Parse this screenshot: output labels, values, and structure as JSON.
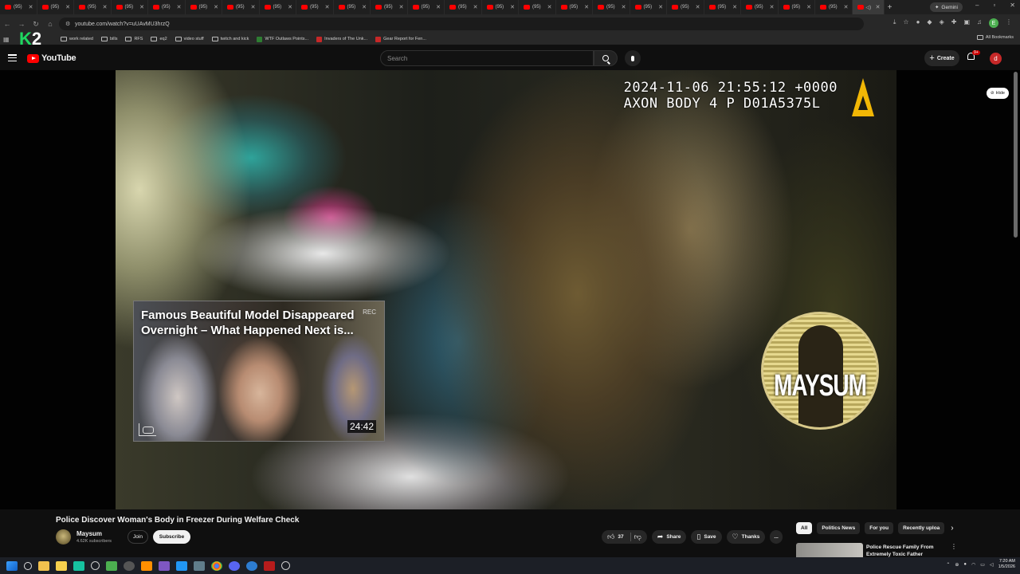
{
  "browser": {
    "tabs": [
      {
        "label": "(95)"
      },
      {
        "label": "(95)"
      },
      {
        "label": "(95)"
      },
      {
        "label": "(95)"
      },
      {
        "label": "(95)"
      },
      {
        "label": "(95)"
      },
      {
        "label": "(95)"
      },
      {
        "label": "(95)"
      },
      {
        "label": "(95)"
      },
      {
        "label": "(95)"
      },
      {
        "label": "(95)"
      },
      {
        "label": "(95)"
      },
      {
        "label": "(95)"
      },
      {
        "label": "(95)"
      },
      {
        "label": "(95)"
      },
      {
        "label": "(95)"
      },
      {
        "label": "(95)"
      },
      {
        "label": "(95)"
      },
      {
        "label": "(95)"
      },
      {
        "label": "(95)"
      },
      {
        "label": "(95)"
      },
      {
        "label": "(95)"
      },
      {
        "label": "(95)"
      }
    ],
    "gemini_label": "Gemini",
    "url": "youtube.com/watch?v=uUAvMU3hrzQ",
    "bookmarks": [
      {
        "label": "work related",
        "icon": "folder-icon"
      },
      {
        "label": "bills",
        "icon": "folder-icon"
      },
      {
        "label": "RFS",
        "icon": "folder-icon"
      },
      {
        "label": "eq2",
        "icon": "folder-icon"
      },
      {
        "label": "video stuff",
        "icon": "folder-icon"
      },
      {
        "label": "twitch and kick",
        "icon": "folder-icon"
      },
      {
        "label": "WTF Outlaws Points...",
        "icon": "site-icon"
      },
      {
        "label": "Invaders of The Unk...",
        "icon": "site-icon"
      },
      {
        "label": "Gear Report for Fen...",
        "icon": "site-icon"
      }
    ],
    "all_bookmarks_label": "All Bookmarks",
    "overlay_logo": "2"
  },
  "youtube": {
    "logo_text": "YouTube",
    "search_placeholder": "Search",
    "create_label": "Create",
    "notifications_badge": "9+",
    "avatar_letter": "d"
  },
  "video": {
    "timestamp_line1": "2024-11-06 21:55:12 +0000",
    "timestamp_line2": "AXON BODY 4 P D01A5375L",
    "watermark_text": "MAYSUM",
    "hide_chip_label": "Hide",
    "endscreen": {
      "title": "Famous Beautiful Model Disappeared Overnight – What Happened Next is...",
      "rec_label": "REC",
      "duration": "24:42"
    }
  },
  "meta": {
    "title": "Police Discover Woman's Body in Freezer During Welfare Check",
    "channel_name": "Maysum",
    "subscribers": "4.62K subscribers",
    "join_label": "Join",
    "subscribe_label": "Subscribe",
    "like_count": "37",
    "share_label": "Share",
    "save_label": "Save",
    "thanks_label": "Thanks",
    "more_label": "..."
  },
  "sidebar": {
    "chips": [
      "All",
      "Politics News",
      "For you",
      "Recently uploa"
    ],
    "rec_title": "Police Rescue Family From Extremely Toxic Father"
  },
  "taskbar": {
    "time": "7:20 AM",
    "date": "1/5/2026"
  },
  "colors": {
    "youtube_red": "#ff0000",
    "page_bg": "#0f0f0f",
    "axon_yellow": "#f2b705"
  }
}
